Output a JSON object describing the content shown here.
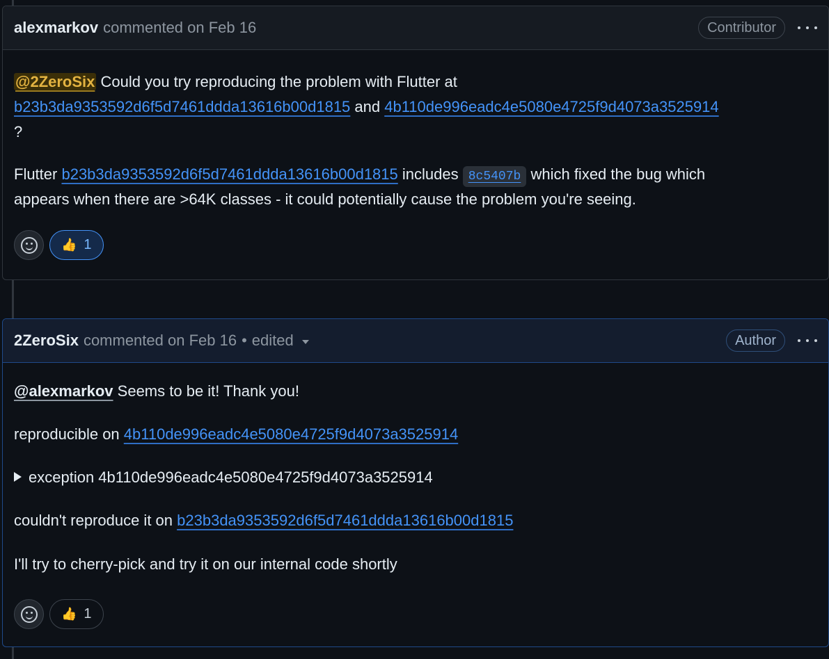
{
  "comment1": {
    "author": "alexmarkov",
    "meta": "commented on Feb 16",
    "badge": "Contributor",
    "mention": "@2ZeroSix",
    "text_a": " Could you try reproducing the problem with Flutter at",
    "link_b23": "b23b3da9353592d6f5d7461ddda13616b00d1815",
    "and": " and ",
    "link_4b1": "4b110de996eadc4e5080e4725f9d4073a3525914",
    "question": "?",
    "flutter_word": "Flutter ",
    "includes": " includes ",
    "commit_chip": "8c5407b",
    "text_b": " which fixed the bug which",
    "text_c": "appears when there are >64K classes - it could potentially cause the problem you're seeing.",
    "reaction_count": "1"
  },
  "comment2": {
    "author": "2ZeroSix",
    "meta": "commented on Feb 16",
    "edited": "edited",
    "badge": "Author",
    "mention": "@alexmarkov",
    "thanks": " Seems to be it! Thank you!",
    "repro_label": "reproducible on ",
    "repro_link": "4b110de996eadc4e5080e4725f9d4073a3525914",
    "details_summary": "exception 4b110de996eadc4e5080e4725f9d4073a3525914",
    "norepro_label": "couldn't reproduce it on ",
    "norepro_link": "b23b3da9353592d6f5d7461ddda13616b00d1815",
    "closing": "I'll try to cherry-pick and try it on our internal code shortly",
    "reaction_count": "1"
  },
  "icons": {
    "reaction": "smiley-icon",
    "thumbs": "thumbs-up-icon",
    "more": "kebab-icon"
  },
  "colors": {
    "link": "#4493f8",
    "mention_highlight": "#e3b341",
    "background": "#0d1117"
  }
}
